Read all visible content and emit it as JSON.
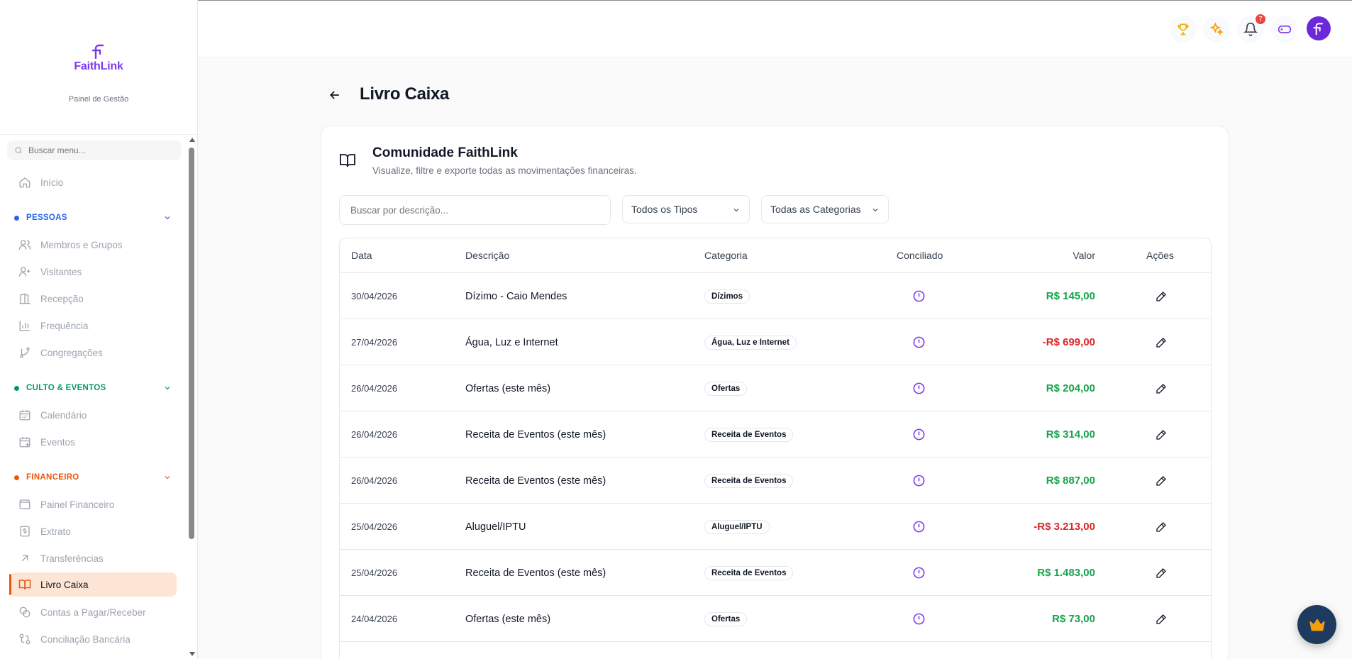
{
  "app": {
    "brand_name": "FaithLink",
    "brand_subtitle": "Painel de Gestão",
    "brand_color": "#7c3aed"
  },
  "sidebar": {
    "search_placeholder": "Buscar menu...",
    "home_label": "Início",
    "sections": [
      {
        "title": "PESSOAS",
        "color": "#2563eb",
        "items": [
          {
            "label": "Membros e Grupos",
            "icon": "users-icon"
          },
          {
            "label": "Visitantes",
            "icon": "user-plus-icon"
          },
          {
            "label": "Recepção",
            "icon": "reception-icon"
          },
          {
            "label": "Frequência",
            "icon": "bar-chart-icon"
          },
          {
            "label": "Congregações",
            "icon": "git-branch-icon"
          }
        ]
      },
      {
        "title": "CULTO & EVENTOS",
        "color": "#059669",
        "items": [
          {
            "label": "Calendário",
            "icon": "calendar-icon"
          },
          {
            "label": "Eventos",
            "icon": "calendar-plus-icon"
          }
        ]
      },
      {
        "title": "FINANCEIRO",
        "color": "#ea580c",
        "items": [
          {
            "label": "Painel Financeiro",
            "icon": "wallet-icon"
          },
          {
            "label": "Extrato",
            "icon": "receipt-icon"
          },
          {
            "label": "Transferências",
            "icon": "arrow-up-right-icon"
          },
          {
            "label": "Livro Caixa",
            "icon": "book-open-icon"
          },
          {
            "label": "Contas a Pagar/Receber",
            "icon": "coins-icon"
          },
          {
            "label": "Conciliação Bancária",
            "icon": "swap-icon"
          }
        ]
      }
    ]
  },
  "topbar": {
    "notification_count": "7",
    "avatar_initial": "F"
  },
  "page": {
    "title": "Livro Caixa"
  },
  "card": {
    "title": "Comunidade FaithLink",
    "subtitle": "Visualize, filtre e exporte todas as movimentações financeiras.",
    "search_placeholder": "Buscar por descrição...",
    "type_filter": "Todos os Tipos",
    "category_filter": "Todas as Categorias"
  },
  "table": {
    "headers": {
      "date": "Data",
      "description": "Descrição",
      "category": "Categoria",
      "reconciled": "Conciliado",
      "value": "Valor",
      "actions": "Ações"
    },
    "rows": [
      {
        "date": "30/04/2026",
        "description": "Dízimo - Caio Mendes",
        "category": "Dízimos",
        "value": "R$ 145,00",
        "type": "pos"
      },
      {
        "date": "27/04/2026",
        "description": "Água, Luz e Internet",
        "category": "Água, Luz e Internet",
        "value": "-R$ 699,00",
        "type": "neg"
      },
      {
        "date": "26/04/2026",
        "description": "Ofertas (este mês)",
        "category": "Ofertas",
        "value": "R$ 204,00",
        "type": "pos"
      },
      {
        "date": "26/04/2026",
        "description": "Receita de Eventos (este mês)",
        "category": "Receita de Eventos",
        "value": "R$ 314,00",
        "type": "pos"
      },
      {
        "date": "26/04/2026",
        "description": "Receita de Eventos (este mês)",
        "category": "Receita de Eventos",
        "value": "R$ 887,00",
        "type": "pos"
      },
      {
        "date": "25/04/2026",
        "description": "Aluguel/IPTU",
        "category": "Aluguel/IPTU",
        "value": "-R$ 3.213,00",
        "type": "neg"
      },
      {
        "date": "25/04/2026",
        "description": "Receita de Eventos (este mês)",
        "category": "Receita de Eventos",
        "value": "R$ 1.483,00",
        "type": "pos"
      },
      {
        "date": "24/04/2026",
        "description": "Ofertas (este mês)",
        "category": "Ofertas",
        "value": "R$ 73,00",
        "type": "pos"
      }
    ]
  }
}
